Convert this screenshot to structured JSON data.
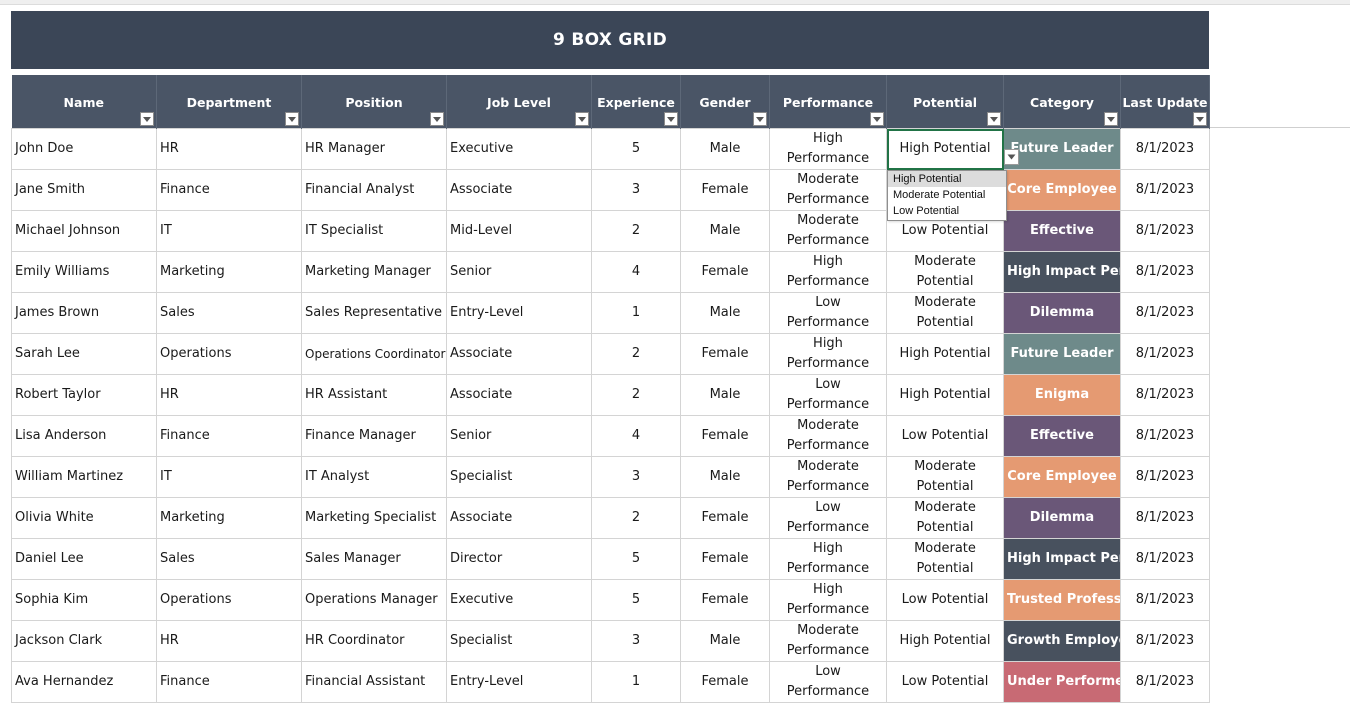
{
  "title": "9 BOX GRID",
  "columns": [
    "Name",
    "Department",
    "Position",
    "Job Level",
    "Experience",
    "Gender",
    "Performance",
    "Potential",
    "Category",
    "Last Update"
  ],
  "rows": [
    {
      "name": "John Doe",
      "department": "HR",
      "position": "HR Manager",
      "job_level": "Executive",
      "experience": "5",
      "gender": "Male",
      "performance": "High Performance",
      "potential": "High Potential",
      "category": "Future Leader",
      "last_update": "8/1/2023"
    },
    {
      "name": "Jane Smith",
      "department": "Finance",
      "position": "Financial Analyst",
      "job_level": "Associate",
      "experience": "3",
      "gender": "Female",
      "performance": "Moderate Performance",
      "potential": "",
      "category": "Core Employee",
      "last_update": "8/1/2023"
    },
    {
      "name": "Michael Johnson",
      "department": "IT",
      "position": "IT Specialist",
      "job_level": "Mid-Level",
      "experience": "2",
      "gender": "Male",
      "performance": "Moderate Performance",
      "potential": "Low Potential",
      "category": "Effective",
      "last_update": "8/1/2023"
    },
    {
      "name": "Emily Williams",
      "department": "Marketing",
      "position": "Marketing Manager",
      "job_level": "Senior",
      "experience": "4",
      "gender": "Female",
      "performance": "High Performance",
      "potential": "Moderate Potential",
      "category": "High Impact Performer",
      "last_update": "8/1/2023"
    },
    {
      "name": "James Brown",
      "department": "Sales",
      "position": "Sales Representative",
      "job_level": "Entry-Level",
      "experience": "1",
      "gender": "Male",
      "performance": "Low Performance",
      "potential": "Moderate Potential",
      "category": "Dilemma",
      "last_update": "8/1/2023"
    },
    {
      "name": "Sarah Lee",
      "department": "Operations",
      "position": "Operations Coordinator",
      "job_level": "Associate",
      "experience": "2",
      "gender": "Female",
      "performance": "High Performance",
      "potential": "High Potential",
      "category": "Future Leader",
      "last_update": "8/1/2023"
    },
    {
      "name": "Robert Taylor",
      "department": "HR",
      "position": "HR Assistant",
      "job_level": "Associate",
      "experience": "2",
      "gender": "Male",
      "performance": "Low Performance",
      "potential": "High Potential",
      "category": "Enigma",
      "last_update": "8/1/2023"
    },
    {
      "name": "Lisa Anderson",
      "department": "Finance",
      "position": "Finance Manager",
      "job_level": "Senior",
      "experience": "4",
      "gender": "Female",
      "performance": "Moderate Performance",
      "potential": "Low Potential",
      "category": "Effective",
      "last_update": "8/1/2023"
    },
    {
      "name": "William Martinez",
      "department": "IT",
      "position": "IT Analyst",
      "job_level": "Specialist",
      "experience": "3",
      "gender": "Male",
      "performance": "Moderate Performance",
      "potential": "Moderate Potential",
      "category": "Core Employee",
      "last_update": "8/1/2023"
    },
    {
      "name": "Olivia White",
      "department": "Marketing",
      "position": "Marketing Specialist",
      "job_level": "Associate",
      "experience": "2",
      "gender": "Female",
      "performance": "Low Performance",
      "potential": "Moderate Potential",
      "category": "Dilemma",
      "last_update": "8/1/2023"
    },
    {
      "name": "Daniel Lee",
      "department": "Sales",
      "position": "Sales Manager",
      "job_level": "Director",
      "experience": "5",
      "gender": "Female",
      "performance": "High Performance",
      "potential": "Moderate Potential",
      "category": "High Impact Performer",
      "last_update": "8/1/2023"
    },
    {
      "name": "Sophia Kim",
      "department": "Operations",
      "position": "Operations Manager",
      "job_level": "Executive",
      "experience": "5",
      "gender": "Female",
      "performance": "High Performance",
      "potential": "Low Potential",
      "category": "Trusted Professional",
      "last_update": "8/1/2023"
    },
    {
      "name": "Jackson Clark",
      "department": "HR",
      "position": "HR Coordinator",
      "job_level": "Specialist",
      "experience": "3",
      "gender": "Male",
      "performance": "Moderate Performance",
      "potential": "High Potential",
      "category": "Growth Employee",
      "last_update": "8/1/2023"
    },
    {
      "name": "Ava Hernandez",
      "department": "Finance",
      "position": "Financial Assistant",
      "job_level": "Entry-Level",
      "experience": "1",
      "gender": "Female",
      "performance": "Low Performance",
      "potential": "Low Potential",
      "category": "Under Performer",
      "last_update": "8/1/2023"
    }
  ],
  "dropdown": {
    "options": [
      "High Potential",
      "Moderate Potential",
      "Low Potential"
    ],
    "highlighted": "High Potential"
  },
  "category_colors": {
    "Future Leader": "#6e8a8a",
    "Core Employee": "#e59a72",
    "Effective": "#6a5778",
    "High Impact Performer": "#48515e",
    "Dilemma": "#6a5778",
    "Enigma": "#e59a72",
    "Trusted Professional": "#e59a72",
    "Growth Employee": "#48515e",
    "Under Performer": "#c86a74"
  },
  "colors": {
    "title_bg": "#3b4657",
    "header_bg": "#4a5566",
    "selection": "#217346"
  },
  "icons": {
    "filter": "filter-dropdown-icon",
    "cell_dropdown": "chevron-down-icon"
  }
}
